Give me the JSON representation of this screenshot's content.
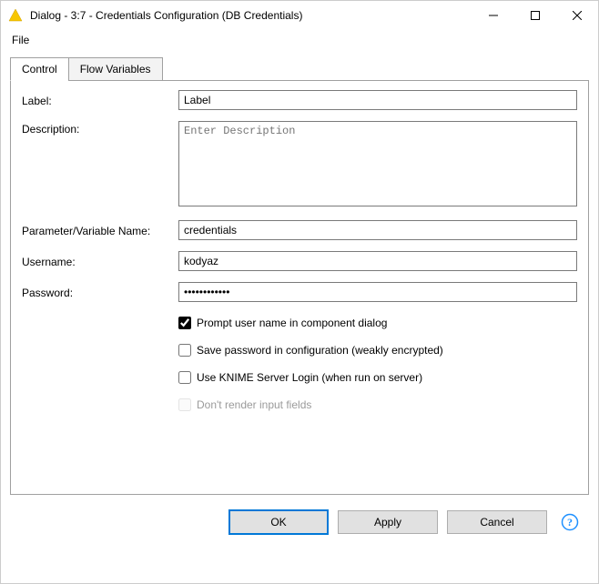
{
  "window": {
    "title": "Dialog - 3:7 - Credentials Configuration (DB Credentials)"
  },
  "menu": {
    "file": "File"
  },
  "tabs": {
    "control": "Control",
    "flow_variables": "Flow Variables"
  },
  "form": {
    "label_label": "Label:",
    "label_value": "Label",
    "description_label": "Description:",
    "description_placeholder": "Enter Description",
    "description_value": "",
    "param_label": "Parameter/Variable Name:",
    "param_value": "credentials",
    "username_label": "Username:",
    "username_value": "kodyaz",
    "password_label": "Password:",
    "password_value": "••••••••••••",
    "cb_prompt": "Prompt user name in component dialog",
    "cb_save": "Save password in configuration (weakly encrypted)",
    "cb_serverlogin": "Use KNIME Server Login (when run on server)",
    "cb_norender": "Don't render input fields"
  },
  "buttons": {
    "ok": "OK",
    "apply": "Apply",
    "cancel": "Cancel"
  }
}
